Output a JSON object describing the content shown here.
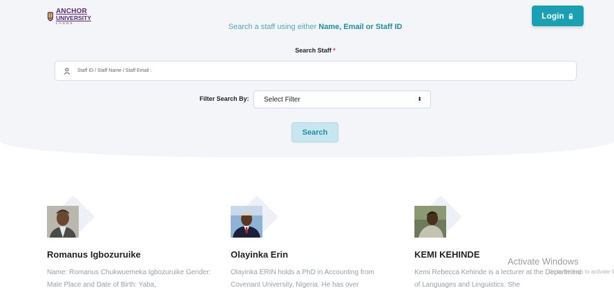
{
  "header": {
    "logo": {
      "line1": "ANCHOR",
      "line2": "UNIVERSITY",
      "line3": "LAGOS"
    },
    "login_label": "Login"
  },
  "search": {
    "subtitle_prefix": "Search a staff using either ",
    "subtitle_highlight": "Name, Email or Staff ID",
    "label": "Search Staff",
    "required_mark": "*",
    "placeholder": "Staff ID / Staff Name / Staff Email :",
    "filter_label": "Filter Search By:",
    "filter_selected": "Select Filter",
    "button_label": "Search"
  },
  "staff": [
    {
      "name": "Romanus Igbozuruike",
      "bio": "Name: Romanus Chukwuemeka Igbozuruike Gender: Male Place and Date of Birth: Yaba,"
    },
    {
      "name": "Olayinka Erin",
      "bio": "Olayinka ERIN holds a PhD in Accounting from Covenant University, Nigeria. He has over"
    },
    {
      "name": "KEMI KEHINDE",
      "bio": "Kemi Rebecca Kehinde is a lecturer at the Department of Languages and Linguistics. She"
    }
  ],
  "watermark": {
    "title": "Activate Windows",
    "subtitle": "Go to Settings to activate Windows."
  },
  "colors": {
    "accent": "#1aa0b3",
    "hero_bg": "#f3f5f8",
    "logo": "#5a2a7a"
  }
}
